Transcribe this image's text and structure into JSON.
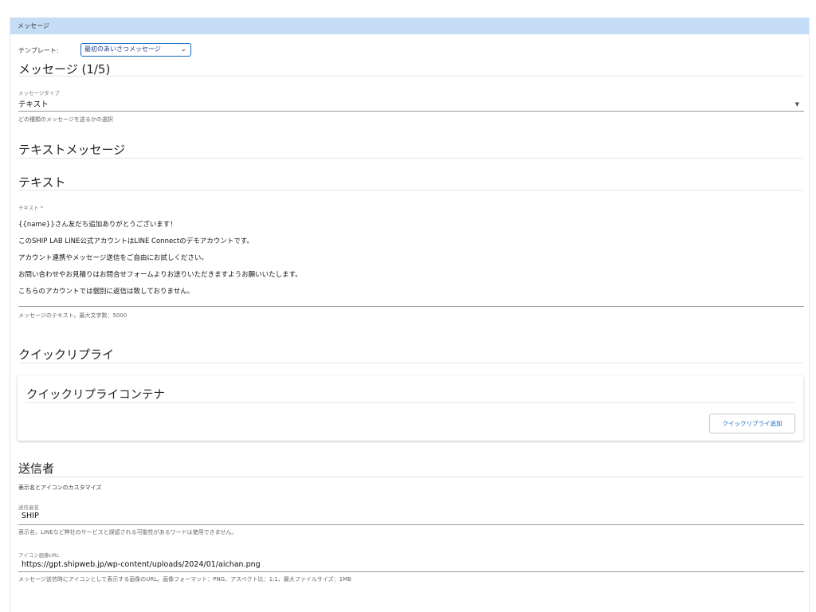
{
  "panel": {
    "title": "メッセージ"
  },
  "template": {
    "label": "テンプレート:",
    "selected": "最初のあいさつメッセージ"
  },
  "message": {
    "heading": "メッセージ (1/5)",
    "type_label": "メッセージタイプ",
    "type_value": "テキスト",
    "type_helper": "どの種類のメッセージを送るかの選択"
  },
  "text_message": {
    "heading": "テキストメッセージ"
  },
  "text_section": {
    "heading": "テキスト",
    "field_label": "テキスト *",
    "lines": [
      "{{name}}さん友だち追加ありがとうございます！",
      "このSHIP LAB LINE公式アカウントはLINE Connectのデモアカウントです。",
      "アカウント連携やメッセージ送信をご自由にお試しください。",
      "お問い合わせやお見積りはお問合せフォームよりお送りいただきますようお願いいたします。",
      "こちらのアカウントでは個別に返信は致しておりません。"
    ],
    "helper": "メッセージのテキスト。最大文字数：5000"
  },
  "quick_reply": {
    "heading": "クイックリプライ",
    "container_title": "クイックリプライコンテナ",
    "add_button": "クイックリプライ追加"
  },
  "sender": {
    "heading": "送信者",
    "description": "表示名とアイコンのカスタマイズ",
    "name_label": "送信者名",
    "name_value": "SHIP",
    "name_helper": "表示名。LINEなど弊社のサービスと誤認される可能性があるワードは使用できません。",
    "icon_label": "アイコン画像URL",
    "icon_value": "https://gpt.shipweb.jp/wp-content/uploads/2024/01/aichan.png",
    "icon_helper": "メッセージ送信時にアイコンとして表示する画像のURL。画像フォーマット：PNG、アスペクト比：1:1、最大ファイルサイズ：1MB"
  },
  "icons": {
    "template_select": "chevron-down-icon",
    "type_select": "caret-down-icon"
  }
}
